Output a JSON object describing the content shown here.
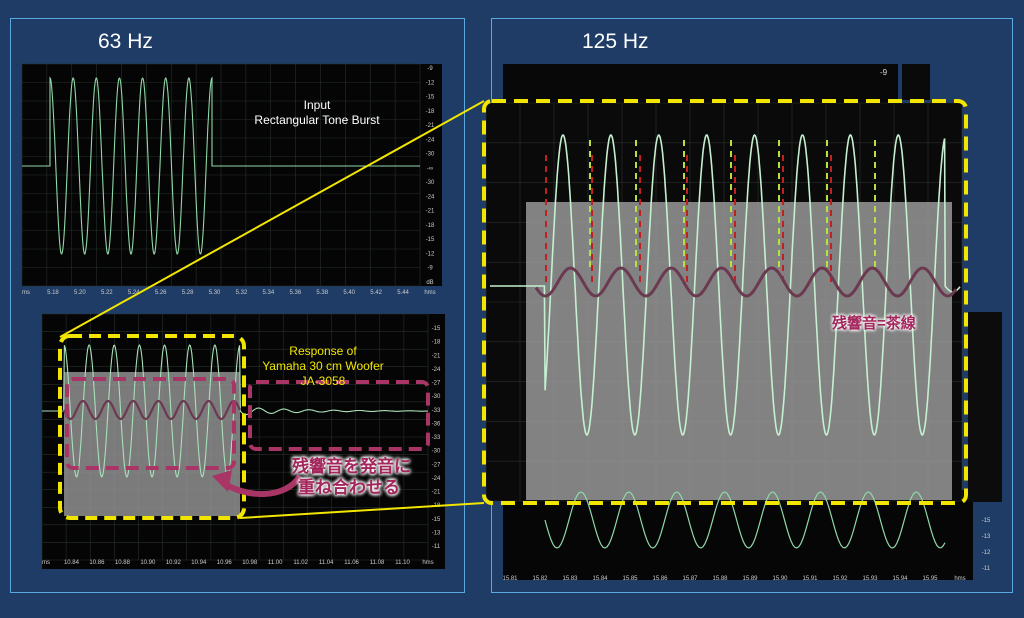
{
  "left_panel": {
    "title": "63 Hz"
  },
  "right_panel": {
    "title": "125 Hz"
  },
  "input_scope": {
    "label_line1": "Input",
    "label_line2": "Rectangular Tone Burst",
    "db_ticks": [
      "-9",
      "-12",
      "-15",
      "-18",
      "-21",
      "-24",
      "-30",
      "-∞",
      "-30",
      "-24",
      "-21",
      "-18",
      "-15",
      "-12",
      "-9",
      "dB"
    ],
    "time_ticks": [
      "ms",
      "5.18",
      "5.20",
      "5.22",
      "5.24",
      "5.26",
      "5.28",
      "5.30",
      "5.32",
      "5.34",
      "5.36",
      "5.38",
      "5.40",
      "5.42",
      "5.44",
      "hms"
    ]
  },
  "response_scope": {
    "label_line1": "Response of",
    "label_line2": "Yamaha 30 cm Woofer",
    "label_line3": "JA-3058",
    "db_ticks": [
      "-15",
      "-18",
      "-21",
      "-24",
      "-27",
      "-30",
      "-33",
      "-36",
      "-33",
      "-30",
      "-27",
      "-24",
      "-21",
      "-18",
      "-15",
      "-13",
      "-11"
    ],
    "time_ticks": [
      "ms",
      "10.84",
      "10.86",
      "10.88",
      "10.90",
      "10.92",
      "10.94",
      "10.96",
      "10.98",
      "11.00",
      "11.02",
      "11.04",
      "11.06",
      "11.08",
      "11.10",
      "hms"
    ]
  },
  "annotation_overlay": {
    "line1": "残響音を発音に",
    "line2": "重ね合わせる"
  },
  "zoom_scope": {
    "top_tick": "-9",
    "right_ticks": [
      "-15",
      "-13",
      "-12",
      "-11"
    ],
    "time_ticks": [
      "15.81",
      "15.82",
      "15.83",
      "15.84",
      "15.85",
      "15.86",
      "15.87",
      "15.88",
      "15.89",
      "15.90",
      "15.91",
      "15.92",
      "15.93",
      "15.94",
      "15.95",
      "hms"
    ]
  },
  "annotation_residual": "残響音=茶線",
  "colors": {
    "background": "#1e3c66",
    "panel_border": "#5aa8e0",
    "highlight_yellow": "#f2e600",
    "residual_magenta": "#a83566",
    "signal_green": "#8fd8a8",
    "annotation_text": "#a3265c"
  }
}
